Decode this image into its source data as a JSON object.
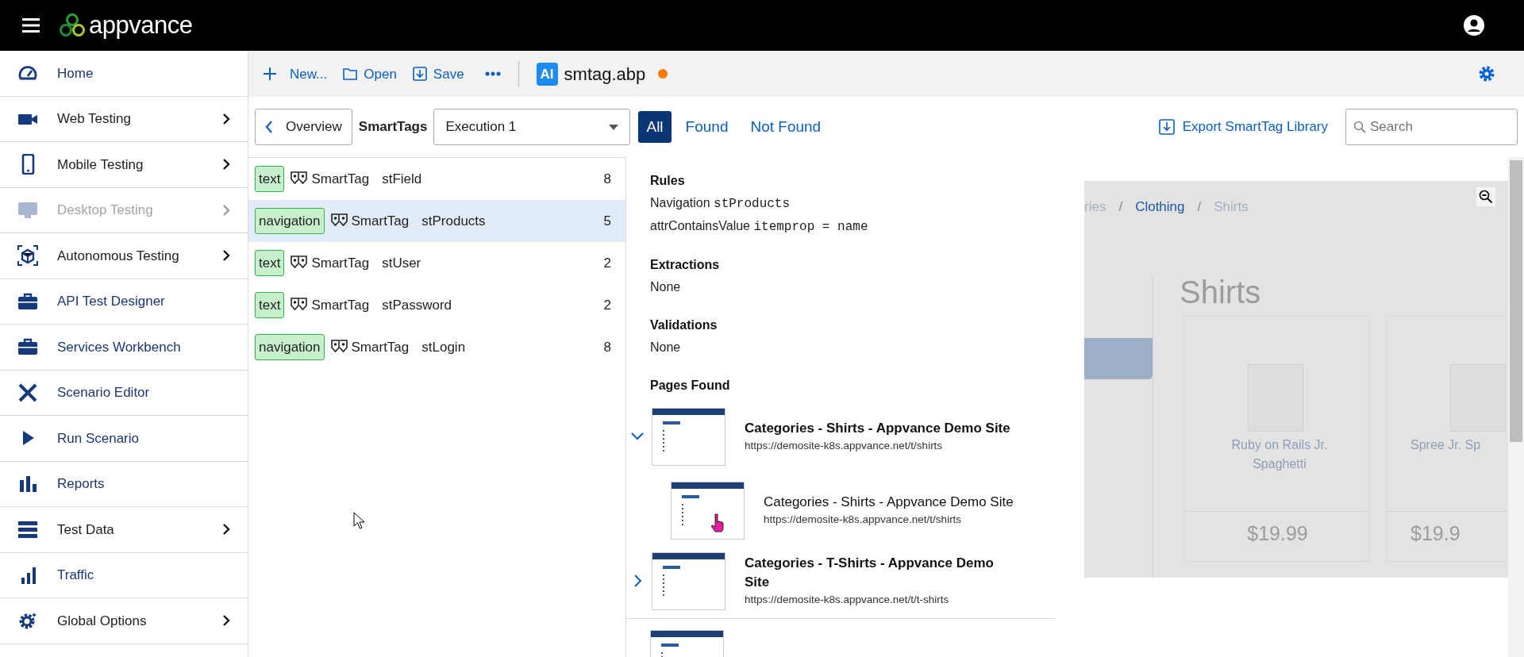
{
  "top_bar": {
    "logo": "appvance"
  },
  "sidebar": {
    "items": [
      {
        "label": "Home",
        "has_submenu": false,
        "disabled": false
      },
      {
        "label": "Web Testing",
        "has_submenu": true,
        "disabled": false
      },
      {
        "label": "Mobile Testing",
        "has_submenu": true,
        "disabled": false
      },
      {
        "label": "Desktop Testing",
        "has_submenu": true,
        "disabled": true
      },
      {
        "label": "Autonomous Testing",
        "has_submenu": true,
        "disabled": false
      },
      {
        "label": "API Test Designer",
        "has_submenu": false,
        "disabled": false
      },
      {
        "label": "Services Workbench",
        "has_submenu": false,
        "disabled": false
      },
      {
        "label": "Scenario Editor",
        "has_submenu": false,
        "disabled": false
      },
      {
        "label": "Run Scenario",
        "has_submenu": false,
        "disabled": false
      },
      {
        "label": "Reports",
        "has_submenu": false,
        "disabled": false
      },
      {
        "label": "Test Data",
        "has_submenu": true,
        "disabled": false
      },
      {
        "label": "Traffic",
        "has_submenu": false,
        "disabled": false
      },
      {
        "label": "Global Options",
        "has_submenu": true,
        "disabled": false
      }
    ]
  },
  "toolbar": {
    "actions": [
      {
        "label": "New..."
      },
      {
        "label": "Open"
      },
      {
        "label": "Save"
      }
    ],
    "file": {
      "badge": "AI",
      "name": "smtag.abp",
      "unsaved": true
    }
  },
  "filter_bar": {
    "back_button": "Overview",
    "section_label": "SmartTags",
    "execution_select": "Execution 1",
    "filters": [
      {
        "label": "All",
        "selected": true
      },
      {
        "label": "Found",
        "selected": false
      },
      {
        "label": "Not Found",
        "selected": false
      }
    ],
    "export_link": "Export SmartTag Library",
    "search": {
      "placeholder": "Search"
    }
  },
  "smarttags": [
    {
      "type": "text",
      "kind_label": "SmartTag",
      "name": "stField",
      "count": "8",
      "selected": false
    },
    {
      "type": "navigation",
      "kind_label": "SmartTag",
      "name": "stProducts",
      "count": "5",
      "selected": true
    },
    {
      "type": "text",
      "kind_label": "SmartTag",
      "name": "stUser",
      "count": "2",
      "selected": false
    },
    {
      "type": "text",
      "kind_label": "SmartTag",
      "name": "stPassword",
      "count": "2",
      "selected": false
    },
    {
      "type": "navigation",
      "kind_label": "SmartTag",
      "name": "stLogin",
      "count": "8",
      "selected": false
    }
  ],
  "detail": {
    "rules_heading": "Rules",
    "rules": [
      {
        "keyword": "Navigation",
        "value": "stProducts"
      },
      {
        "keyword": "attrContainsValue",
        "value": "itemprop = name"
      }
    ],
    "extractions": {
      "heading": "Extractions",
      "value": "None"
    },
    "validations": {
      "heading": "Validations",
      "value": "None"
    },
    "pages_heading": "Pages Found",
    "pages": [
      {
        "title": "Categories - Shirts - Appvance Demo Site",
        "url": "https://demosite-k8s.appvance.net/t/shirts",
        "expanded": true,
        "children": [
          {
            "title": "Categories - Shirts - Appvance Demo Site",
            "url": "https://demosite-k8s.appvance.net/t/shirts"
          }
        ]
      },
      {
        "title": "Categories - T-Shirts - Appvance Demo Site",
        "url": "https://demosite-k8s.appvance.net/t/t-shirts",
        "expanded": false
      }
    ]
  },
  "preview": {
    "breadcrumb": [
      {
        "label": "ries"
      },
      {
        "separator": "/",
        "label": "Clothing"
      },
      {
        "separator": "/",
        "label": "Shirts"
      }
    ],
    "heading": "Shirts",
    "products": [
      {
        "name": "Ruby on Rails Jr. Spaghetti",
        "price": "$19.99"
      },
      {
        "name": "Spree Jr. Sp",
        "price": "$19.9"
      }
    ]
  }
}
